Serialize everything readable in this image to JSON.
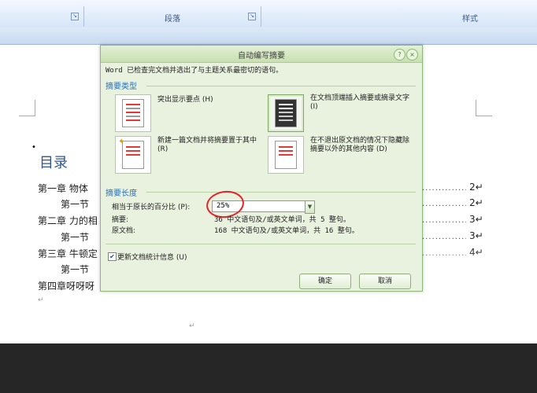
{
  "ribbon": {
    "groups": [
      {
        "label": ""
      },
      {
        "label": "段落"
      },
      {
        "label": "样式"
      }
    ]
  },
  "document": {
    "toc_title": "目录",
    "return_mark": "↵",
    "lines": [
      {
        "text": "第一章  物体",
        "page": "2↵"
      },
      {
        "text": "第一节",
        "page": "2↵"
      },
      {
        "text": "第二章 力的相",
        "page": "3↵"
      },
      {
        "text": "第一节",
        "page": "3↵"
      },
      {
        "text": "第三章 牛顿定",
        "page": "4↵"
      },
      {
        "text": "第一节",
        "page": ""
      },
      {
        "text": "第四章呀呀呀",
        "page": ""
      }
    ]
  },
  "dialog": {
    "title": "自动编写摘要",
    "help_icon": "?",
    "close_icon": "×",
    "message": "Word 已检查完文档并选出了与主题关系最密切的语句。",
    "type_section": "摘要类型",
    "options": [
      {
        "label": "突出显示要点 (H)"
      },
      {
        "label": "在文档顶端插入摘要或摘录文字 (I)"
      },
      {
        "label": "新建一篇文档并将摘要置于其中 (R)"
      },
      {
        "label": "在不退出原文档的情况下隐藏除摘要以外的其他内容 (D)"
      }
    ],
    "length_section": "摘要长度",
    "percent_label": "相当于原长的百分比 (P):",
    "percent_value": "25%",
    "summary_label": "摘要:",
    "summary_value": "36 中文语句及/或英文单词，共 5 整句。",
    "original_label": "原文档:",
    "original_value": "168 中文语句及/或英文单词，共 16 整句。",
    "update_checkbox_label": "更新文档统计信息 (U)",
    "update_checked": true,
    "ok_label": "确定",
    "cancel_label": "取消"
  }
}
